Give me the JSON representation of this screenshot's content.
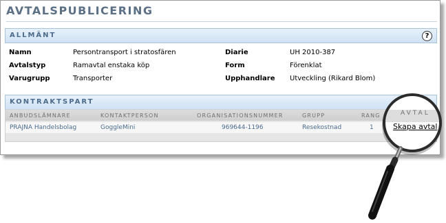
{
  "page": {
    "title": "AVTALSPUBLICERING"
  },
  "general": {
    "header": "ALLMÄNT",
    "help_glyph": "?",
    "labels": {
      "namn": "Namn",
      "avtalstyp": "Avtalstyp",
      "varugrupp": "Varugrupp",
      "diarie": "Diarie",
      "form": "Form",
      "upphandlare": "Upphandlare"
    },
    "values": {
      "namn": "Persontransport i stratosfären",
      "avtalstyp": "Ramavtal enstaka köp",
      "varugrupp": "Transporter",
      "diarie": "UH 2010-387",
      "form": "Förenklat",
      "upphandlare": "Utveckling (Rikard Blom)"
    }
  },
  "contract_party": {
    "header": "KONTRAKTSPART",
    "columns": [
      "ANBUDSLÄMNARE",
      "KONTAKTPERSON",
      "ORGANISATIONSNUMMER",
      "GRUPP",
      "RANG",
      "AVTAL"
    ],
    "rows": [
      {
        "anbudslamnare": "PRAJNA Handelsbolag",
        "kontaktperson": "GoggleMini",
        "organisationsnummer": "969644-1196",
        "grupp": "Resekostnad",
        "rang": "1",
        "avtal_link": "Skapa avtal"
      }
    ]
  },
  "colors": {
    "title": "#5b6f85",
    "section_header_bg": "#cfe2f4",
    "link_text": "#4a6b8f"
  },
  "icons": {
    "help": "help-icon",
    "magnifier": "magnifier-icon"
  }
}
